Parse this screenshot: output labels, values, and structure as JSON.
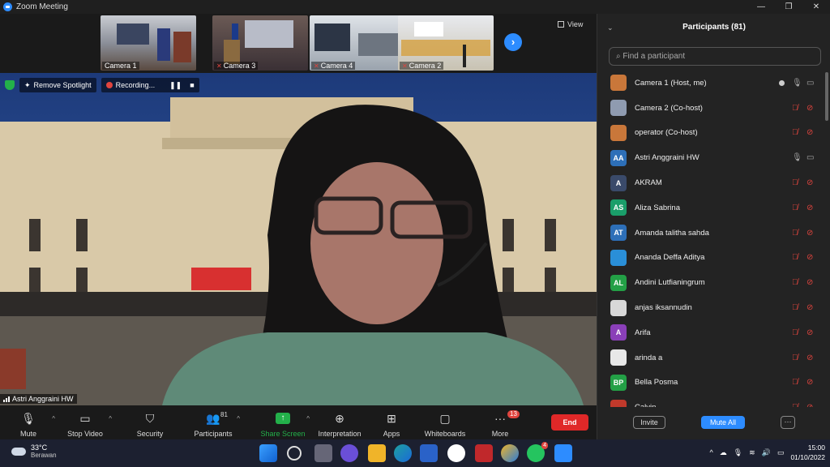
{
  "window": {
    "title": "Zoom Meeting",
    "controls": [
      "—",
      "❐",
      "✕"
    ]
  },
  "thumbnails": [
    {
      "label": "Camera 1"
    },
    {
      "label": "Camera 3"
    },
    {
      "label": "Camera 4"
    },
    {
      "label": "Camera 2"
    }
  ],
  "view_label": "View",
  "spotlight": {
    "remove_label": "Remove Spotlight",
    "recording_label": "Recording..."
  },
  "main_video": {
    "name": "Astri Anggraini HW"
  },
  "toolbar": {
    "mute": "Mute",
    "stop_video": "Stop Video",
    "security": "Security",
    "participants": "Participants",
    "participants_count": "81",
    "share_screen": "Share Screen",
    "interpretation": "Interpretation",
    "apps": "Apps",
    "whiteboards": "Whiteboards",
    "more": "More",
    "more_badge": "13",
    "end": "End"
  },
  "panel": {
    "title": "Participants (81)",
    "search_placeholder": "Find a participant",
    "invite": "Invite",
    "mute_all": "Mute All",
    "more": "···",
    "participants": [
      {
        "name": "Camera 1 (Host, me)",
        "avatar": "",
        "color": "#c9773a",
        "mic": "on",
        "cam": "on",
        "host_dot": true
      },
      {
        "name": "Camera 2 (Co-host)",
        "avatar": "",
        "color": "#8f9bb0",
        "mic": "off",
        "cam": "off"
      },
      {
        "name": "operator (Co-host)",
        "avatar": "",
        "color": "#c9773a",
        "mic": "off",
        "cam": "off"
      },
      {
        "name": "Astri Anggraini HW",
        "avatar": "AA",
        "color": "#2d6fb8",
        "mic": "on",
        "cam": "on"
      },
      {
        "name": "AKRAM",
        "avatar": "A",
        "color": "#3a4a6a",
        "mic": "off",
        "cam": "off"
      },
      {
        "name": "Aliza Sabrina",
        "avatar": "AS",
        "color": "#1a9e6a",
        "mic": "off",
        "cam": "off"
      },
      {
        "name": "Amanda talitha sahda",
        "avatar": "AT",
        "color": "#2d6fb8",
        "mic": "off",
        "cam": "off"
      },
      {
        "name": "Ananda Deffa Aditya",
        "avatar": "",
        "color": "#2a8fd8",
        "mic": "off",
        "cam": "off"
      },
      {
        "name": "Andini Lutfianingrum",
        "avatar": "AL",
        "color": "#23a046",
        "mic": "off",
        "cam": "off"
      },
      {
        "name": "anjas iksannudin",
        "avatar": "",
        "color": "#d8d8d8",
        "mic": "off",
        "cam": "off"
      },
      {
        "name": "Arifa",
        "avatar": "A",
        "color": "#8a3fb8",
        "mic": "off",
        "cam": "off"
      },
      {
        "name": "arinda a",
        "avatar": "",
        "color": "#e8e8e8",
        "mic": "off",
        "cam": "off"
      },
      {
        "name": "Bella Posma",
        "avatar": "BP",
        "color": "#23a046",
        "mic": "off",
        "cam": "off"
      },
      {
        "name": "Calvin",
        "avatar": "",
        "color": "#c0392b",
        "mic": "off",
        "cam": "off"
      }
    ]
  },
  "taskbar": {
    "temperature": "33°C",
    "weather": "Berawan",
    "whatsapp_badge": "4",
    "time": "15:00",
    "date": "01/10/2022"
  }
}
